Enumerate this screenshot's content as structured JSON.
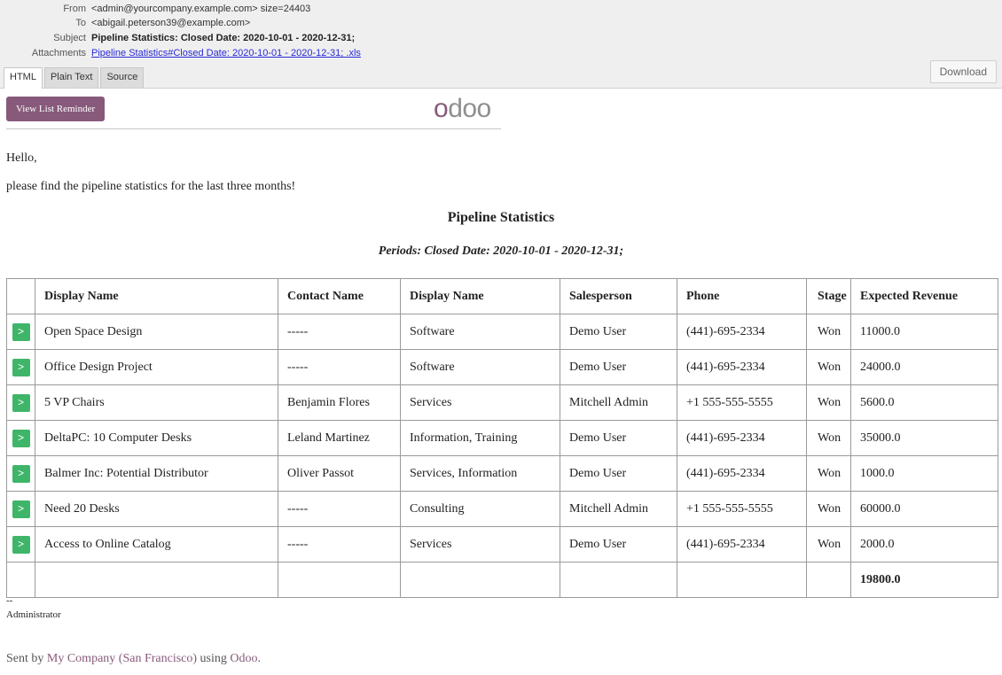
{
  "header": {
    "from_label": "From",
    "from_value": "<admin@yourcompany.example.com> size=24403",
    "to_label": "To",
    "to_value": "<abigail.peterson39@example.com>",
    "subject_label": "Subject",
    "subject_value": "Pipeline Statistics: Closed Date: 2020-10-01 - 2020-12-31;",
    "attachments_label": "Attachments",
    "attachment_link": "Pipeline Statistics#Closed Date: 2020-10-01 - 2020-12-31; .xls",
    "tabs": [
      {
        "label": "HTML",
        "active": true
      },
      {
        "label": "Plain Text",
        "active": false
      },
      {
        "label": "Source",
        "active": false
      }
    ],
    "download_label": "Download"
  },
  "body": {
    "reminder_button": "View List Reminder",
    "logo_text_1": "o",
    "logo_text_2": "doo",
    "greeting": "Hello,",
    "intro": "please find the pipeline statistics for the last three months!",
    "title": "Pipeline Statistics",
    "period": "Periods: Closed Date: 2020-10-01 - 2020-12-31;",
    "arrow_glyph": ">",
    "columns": [
      "Display Name",
      "Contact Name",
      "Display Name",
      "Salesperson",
      "Phone",
      "Stage",
      "Expected Revenue"
    ],
    "rows": [
      [
        "Open Space Design",
        "-----",
        "Software",
        "Demo User",
        "(441)-695-2334",
        "Won",
        "11000.0"
      ],
      [
        "Office Design Project",
        "-----",
        "Software",
        "Demo User",
        "(441)-695-2334",
        "Won",
        "24000.0"
      ],
      [
        "5 VP Chairs",
        "Benjamin Flores",
        "Services",
        "Mitchell Admin",
        "+1 555-555-5555",
        "Won",
        "5600.0"
      ],
      [
        "DeltaPC: 10 Computer Desks",
        "Leland Martinez",
        "Information, Training",
        "Demo User",
        "(441)-695-2334",
        "Won",
        "35000.0"
      ],
      [
        "Balmer Inc: Potential Distributor",
        "Oliver Passot",
        "Services, Information",
        "Demo User",
        "(441)-695-2334",
        "Won",
        "1000.0"
      ],
      [
        "Need 20 Desks",
        "-----",
        "Consulting",
        "Mitchell Admin",
        "+1 555-555-5555",
        "Won",
        "60000.0"
      ],
      [
        "Access to Online Catalog",
        "-----",
        "Services",
        "Demo User",
        "(441)-695-2334",
        "Won",
        "2000.0"
      ]
    ],
    "total": "19800.0",
    "signature_dash": "--",
    "signature_name": "Administrator",
    "footer_sent_by": "Sent by ",
    "footer_company": "My Company (San Francisco)",
    "footer_using": " using ",
    "footer_odoo": "Odoo",
    "footer_end": "."
  }
}
